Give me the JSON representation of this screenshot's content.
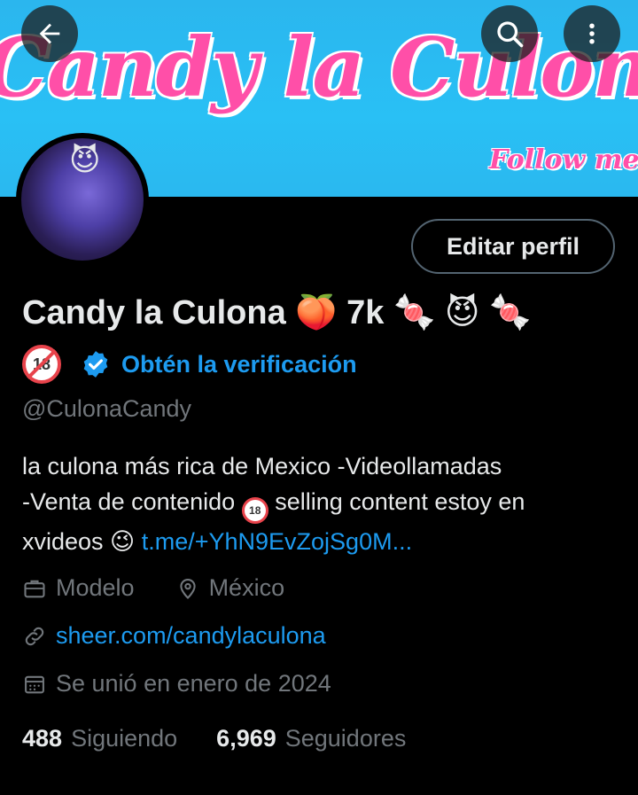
{
  "banner": {
    "title": "Candy la Culona",
    "follow_text": "Follow me"
  },
  "header": {
    "back_icon": "arrow-left-icon",
    "search_icon": "search-icon",
    "more_icon": "more-vertical-icon"
  },
  "avatar": {
    "emoji": "😈"
  },
  "profile": {
    "edit_button": "Editar perfil",
    "name": "Candy la Culona 🍑 7k 🍬 😈 🍬",
    "badge_18": "18",
    "verification_text": "Obtén la verificación",
    "handle": "@CulonaCandy",
    "bio_line1": "la culona más rica de Mexico  -Videollamadas",
    "bio_line2_a": "-Venta de contenido ",
    "bio_line2_b": " selling content estoy en",
    "bio_line3": "xvideos 😉 ",
    "bio_link": "t.me/+YhN9EvZojSg0M...",
    "profession": "Modelo",
    "location": "México",
    "website": "sheer.com/candylaculona",
    "joined": "Se unió en enero de 2024"
  },
  "stats": {
    "following_count": "488",
    "following_label": "Siguiendo",
    "followers_count": "6,969",
    "followers_label": "Seguidores"
  },
  "colors": {
    "accent": "#1d9bf0",
    "banner_bg": "#2bb6ee",
    "banner_text": "#ff4fa8",
    "muted": "#71767b"
  }
}
